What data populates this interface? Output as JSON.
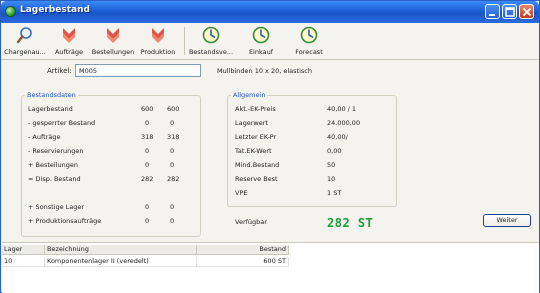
{
  "window": {
    "title": "Lagerbestand"
  },
  "toolbar": {
    "items": [
      {
        "label": "Chargenau...",
        "icon": "magnifier-icon"
      },
      {
        "label": "Aufträge",
        "icon": "arrow-down-icon"
      },
      {
        "label": "Bestellungen",
        "icon": "arrow-down-icon"
      },
      {
        "label": "Produktion",
        "icon": "arrow-down-icon"
      },
      {
        "label": "Bestandsve...",
        "icon": "clock-icon"
      },
      {
        "label": "Einkauf",
        "icon": "clock-icon"
      },
      {
        "label": "Forecast",
        "icon": "clock-icon"
      }
    ]
  },
  "artikel": {
    "label": "Artikel:",
    "value": "M005",
    "description": "Mullbinden 10 x 20, elastisch"
  },
  "bestandsdaten": {
    "title": "Bestandsdaten",
    "rows": [
      {
        "label": "Lagerbestand",
        "v1": "600",
        "v2": "600"
      },
      {
        "label": "- gesperrter Bestand",
        "v1": "0",
        "v2": "0"
      },
      {
        "label": "- Aufträge",
        "v1": "318",
        "v2": "318"
      },
      {
        "label": "- Reservierungen",
        "v1": "0",
        "v2": "0"
      },
      {
        "label": "+ Bestellungen",
        "v1": "0",
        "v2": "0"
      },
      {
        "label": "= Disp. Bestand",
        "v1": "282",
        "v2": "282"
      },
      {
        "label": "+ Sonstige Lager",
        "v1": "0",
        "v2": "0"
      },
      {
        "label": "+ Produktionsaufträge",
        "v1": "0",
        "v2": "0"
      }
    ]
  },
  "allgemein": {
    "title": "Allgemein",
    "rows": [
      {
        "label": "Akt.-EK-Preis",
        "value": "40,00 / 1"
      },
      {
        "label": "Lagerwert",
        "value": "24.000,00"
      },
      {
        "label": "Letzter EK-Pr",
        "value": "40,00/"
      },
      {
        "label": "Tat.EK-Wert",
        "value": "0,00"
      },
      {
        "label": "Mind.Bestand",
        "value": "50"
      },
      {
        "label": "Reserve Best",
        "value": "10"
      },
      {
        "label": "VPE",
        "value": "1 ST"
      }
    ]
  },
  "verfuegbar": {
    "label": "Verfügbar",
    "value": "282 ST"
  },
  "weiter_button": "Weiter",
  "table": {
    "headers": [
      "Lager",
      "Bezeichnung",
      "Bestand"
    ],
    "rows": [
      {
        "lager": "10",
        "bezeichnung": "Komponentenlager II (veredelt)",
        "bestand": "600 ST"
      }
    ]
  },
  "colors": {
    "title_bar": "#1c5fd8",
    "group_title": "#2156c8",
    "verfuegbar_value": "#1e9a3a",
    "toolbar_arrow": "#e0524a"
  }
}
